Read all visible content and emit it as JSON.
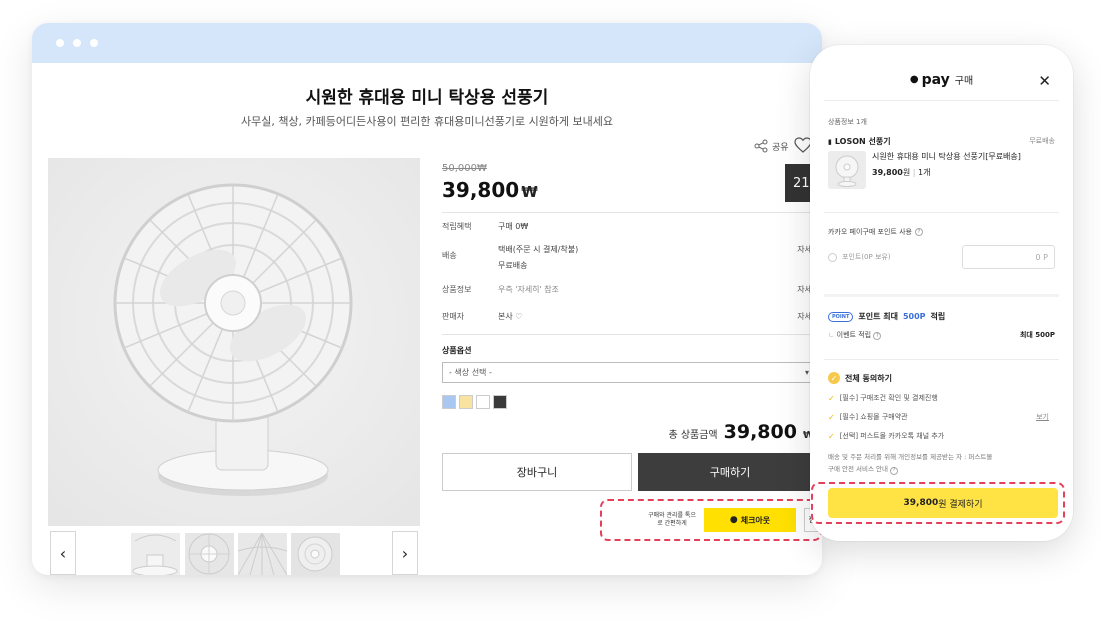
{
  "product": {
    "title": "시원한 휴대용 미니 탁상용 선풍기",
    "subtitle": "사무실, 책상, 카페등어디든사용이 편리한 휴대용미니선풍기로 시원하게 보내세요",
    "share_label": "공유",
    "old_price": "50,000₩",
    "price": "39,800",
    "price_currency": "₩",
    "badge": "21",
    "rows": [
      {
        "label": "적립혜택",
        "value": "구매 0₩",
        "more": ""
      },
      {
        "label": "배송",
        "value": "택배(주문 시 결제/착불)",
        "value2": "무료배송",
        "more": "자세"
      },
      {
        "label": "상품정보",
        "value": "우측 '자세히' 참조",
        "more": "자세"
      },
      {
        "label": "판매자",
        "value": "본사",
        "more": "자세"
      }
    ],
    "option_title": "상품옵션",
    "select_placeholder": "- 색상 선택 -",
    "swatches": [
      "#a8c8f2",
      "#f8e4a0",
      "#ffffff",
      "#3a3a3a"
    ],
    "total_label": "총 상품금액",
    "total_value": "39,800",
    "total_currency": "₩",
    "cart_label": "장바구니",
    "buy_label": "구매하기",
    "checkout_desc": "구매와 관리를 톡으로 간편하게",
    "checkout_label": "체크아웃",
    "checkout_extra": "찜"
  },
  "pay": {
    "brand": "pay",
    "title": "구매",
    "section_label": "상품정보 1개",
    "seller": "LOSON 선풍기",
    "shipping": "무료배송",
    "item_name": "시원한 휴대용 미니 탁상용 선풍기[무료배송]",
    "item_price": "39,800",
    "item_price_unit": "원",
    "item_qty": "1개",
    "kakao_point_label": "카카오 페이구매 포인트 사용",
    "point_option": "포인트(0P 보유)",
    "point_input": "0 P",
    "point_badge": "POINT",
    "point_max_prefix": "포인트 최대",
    "point_max_value": "500P",
    "point_max_suffix": "적립",
    "event_label": "이벤트 적립",
    "event_value": "최대 500P",
    "agree_all": "전체 동의하기",
    "agree_items": [
      {
        "label": "[필수] 구매조건 확인 및 결제진행",
        "link": ""
      },
      {
        "label": "[필수] 쇼핑몰 구매약관",
        "link": "보기"
      },
      {
        "label": "[선택] 퍼스트몰 카카오톡 채널 추가",
        "link": ""
      }
    ],
    "notice_line1": "배송 및 주문 처리를 위해 개인정보를 제공받는 자 : 퍼스트몰",
    "notice_line2": "구매 안전 서비스 안내",
    "pay_amount": "39,800",
    "pay_suffix": "원 결제하기"
  },
  "colors": {
    "browser_bar": "#d5e6fb",
    "buy_button": "#3d3d3d",
    "kakao_yellow": "#ffe000",
    "highlight_dash": "#e4405a",
    "point_blue": "#3a6fd8"
  }
}
